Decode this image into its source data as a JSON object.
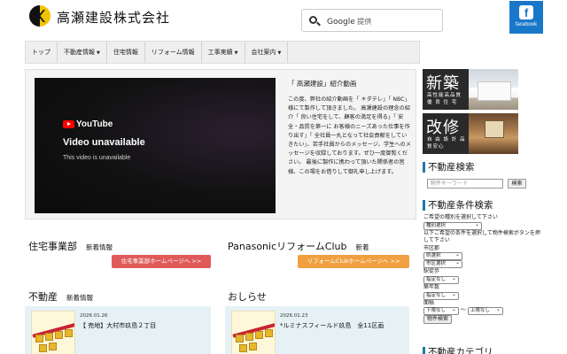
{
  "header": {
    "site_title": "高瀬建設株式会社",
    "search": {
      "brand": "Google",
      "placeholder": "提供"
    },
    "facebook_label": "facebook"
  },
  "nav": {
    "items": [
      {
        "label": "トップ",
        "has_dropdown": false
      },
      {
        "label": "不動産情報",
        "has_dropdown": true
      },
      {
        "label": "住宅情報",
        "has_dropdown": false
      },
      {
        "label": "リフォーム情報",
        "has_dropdown": false
      },
      {
        "label": "工事実績",
        "has_dropdown": true
      },
      {
        "label": "会社案内",
        "has_dropdown": true
      }
    ],
    "caret": "▼"
  },
  "video": {
    "yt_brand": "YouTube",
    "unavailable": "Video unavailable",
    "unavailable_sub": "This video is unavailable",
    "heading": "「 高瀬建設」紹介動画",
    "description": "この度、弊社の紹介動画を「 ＊ダテレ」「 NBC」様にて製作して頂きました。 高瀬建設の理念の紹介「 良い住宅をして、顧客の満足を得る」「 安全・品質を第一に お客様のニーズあった仕事を作り出す」「 全社員一丸となって社会貢献をしていきたい」、若手社員からのメッセージ、学生へのメッセージを収録しております。ぜひ一度御覧ください。 最後に製作に携わって頂いた関係者の皆様、この場をお借りして御礼申し上げます。"
  },
  "sidebar": {
    "banner1": {
      "big": "新築",
      "small": "高性能高品質 優 良 住 宅"
    },
    "banner2": {
      "big": "改修",
      "small": "自 由 設 計 品質安心"
    },
    "search_heading": "不動産検索",
    "keyword_placeholder": "物件キーワード",
    "search_button": "検索",
    "cond_heading": "不動産条件検索",
    "cond_intro": "ご希望の種別を選択して下さい",
    "type_select": "種別選択",
    "cond_note": "以下ご希望の条件を選択して物件検索ボタンを押して下さい",
    "city_label": "市区郡",
    "pref_select": "県選択",
    "city_select": "市区選択",
    "station_label": "駅徒歩",
    "station_select": "指定なし",
    "age_label": "築年数",
    "age_select": "指定なし",
    "area_label": "面積",
    "area_min": "下限なし",
    "area_sep": "〜",
    "area_max": "上限なし",
    "search_props_button": "物件検索",
    "footer_heading": "不動産カテゴリ"
  },
  "sections": {
    "housing": {
      "title": "住宅事業部",
      "sub": "新着情報",
      "button": "住宅事業部ホームページへ >>"
    },
    "reform": {
      "title": "PanasonicリフォームClub",
      "sub": "新着",
      "button": "リフォームClubホームページへ >>"
    },
    "realestate": {
      "title": "不動産",
      "sub": "新着情報",
      "news_date": "2026.01.26",
      "news_title": "【 売地】大村市玖島２丁目"
    },
    "notice": {
      "title": "おしらせ",
      "news_date": "2026.01.23",
      "news_title": "*ルミナスフィールド玖島　全11区画"
    }
  },
  "colors": {
    "accent_blue": "#2277aa",
    "facebook": "#1877c9",
    "housing_button": "#e05a5a",
    "reform_button": "#f0a040",
    "news_bg": "#e6f1f6",
    "logo_yellow": "#f2c300"
  }
}
